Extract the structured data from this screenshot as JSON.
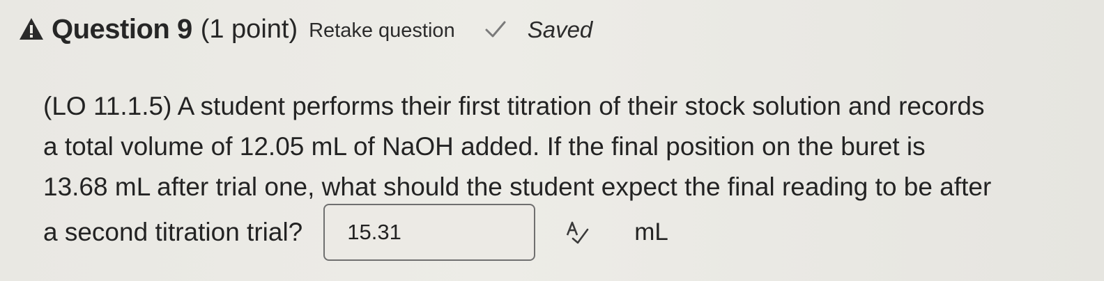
{
  "header": {
    "icon": "warning-triangle-icon",
    "title": "Question 9",
    "points": "(1 point)",
    "retake_label": "Retake question",
    "status_icon": "checkmark-icon",
    "status_label": "Saved"
  },
  "question": {
    "lines": [
      "(LO 11.1.5) A student performs their first titration of their stock solution and records",
      "a total volume of 12.05 mL of NaOH added.  If the final position on the buret is",
      "13.68 mL after trial one, what should the student expect the final reading to be after"
    ],
    "prompt_tail": "a second titration trial?",
    "answer_value": "15.31",
    "spellcheck_icon": "spellcheck-icon",
    "unit": "mL"
  }
}
